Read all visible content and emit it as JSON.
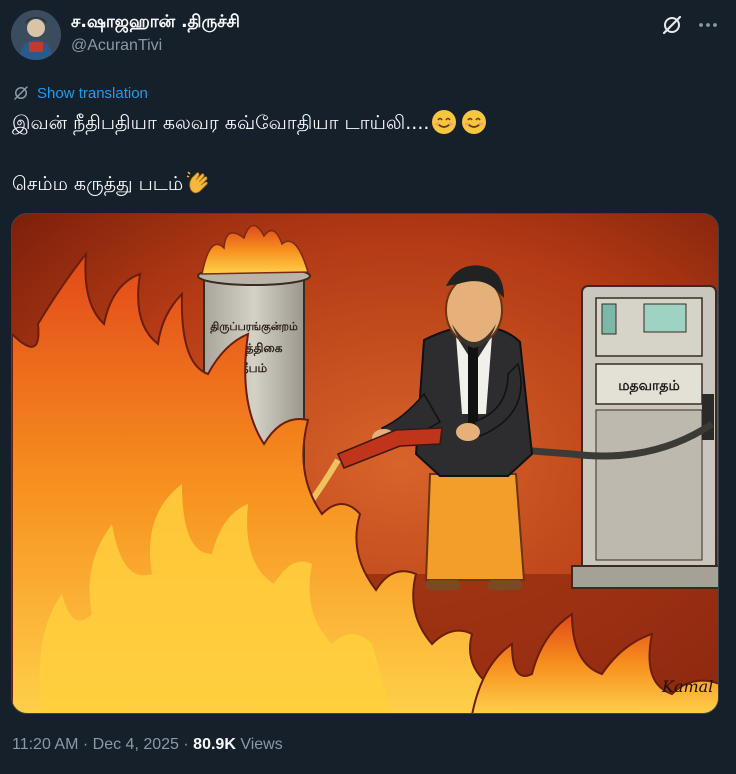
{
  "author": {
    "display_name": "ச.ஷாஜஹான் .திருச்சி",
    "handle": "@AcuranTivi"
  },
  "translate": {
    "label": "Show translation"
  },
  "tweet": {
    "line1": "இவன் நீதிபதியா கலவர கவ்வோதியா டாய்லி....",
    "line2": "செம்ம கருத்து படம்"
  },
  "cartoon": {
    "pillar_label_1": "திருப்பரங்குன்றம்",
    "pillar_label_2": "கார்த்திகை",
    "pillar_label_3": "தீபம்",
    "pump_label": "மதவாதம்",
    "signature": "Kamal"
  },
  "footer": {
    "time": "11:20 AM",
    "separator": "·",
    "date": "Dec 4, 2025",
    "views_count": "80.9K",
    "views_label": "Views"
  },
  "icons": [
    "grok-icon",
    "more-icon",
    "translate-icon",
    "smile-emoji",
    "clap-emoji"
  ],
  "colors": {
    "background": "#15202b",
    "link": "#1d9bf0",
    "muted": "#8b98a5"
  }
}
